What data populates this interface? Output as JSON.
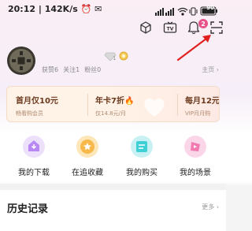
{
  "status_bar": {
    "time": "20:12",
    "network_speed": "142K/s",
    "battery": "90"
  },
  "top_bar": {
    "notification_count": "2",
    "icons": [
      "cube-icon",
      "tv-icon",
      "bell-icon",
      "scan-icon"
    ]
  },
  "profile": {
    "stats": [
      "获赞6",
      "关注1",
      "粉丝0"
    ],
    "level_badge": "1",
    "homepage_label": "主页"
  },
  "vip": {
    "items": [
      {
        "title": "首月仅10元",
        "subtitle": "畅看购会员"
      },
      {
        "title": "年卡7折",
        "subtitle": "仅14.8元/月"
      },
      {
        "title": "每月12元",
        "subtitle": "VIP月月购"
      }
    ]
  },
  "quick_actions": [
    {
      "label": "我的下载",
      "icon": "download-icon",
      "color": "#b889f2"
    },
    {
      "label": "在追收藏",
      "icon": "star-icon",
      "color": "#f7b94a"
    },
    {
      "label": "我的购买",
      "icon": "purchase-icon",
      "color": "#3ed0d6"
    },
    {
      "label": "我的场景",
      "icon": "scene-icon",
      "color": "#f17ab0"
    }
  ],
  "history": {
    "title": "历史记录",
    "more_label": "更多"
  },
  "colors": {
    "accent": "#e8508a",
    "vip_text": "#6b3a1e"
  }
}
